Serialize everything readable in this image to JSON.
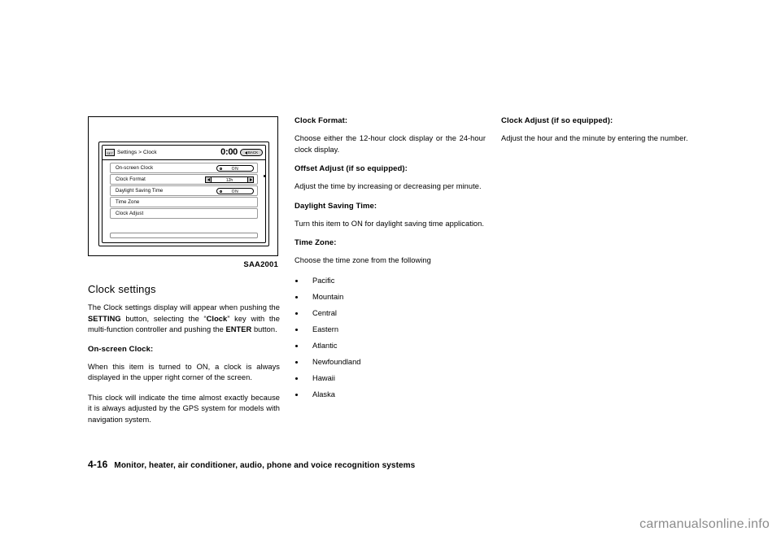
{
  "figure": {
    "id": "SAA2001",
    "titlebar": {
      "icon": "settings-icon",
      "title": "Settings > Clock",
      "clock": "0:00",
      "back_label": "BACK"
    },
    "rows": [
      {
        "label": "On-screen Clock",
        "control": "toggle",
        "value": "ON"
      },
      {
        "label": "Clock Format",
        "control": "stepper",
        "value": "12h"
      },
      {
        "label": "Daylight Saving Time",
        "control": "toggle",
        "value": "ON"
      },
      {
        "label": "Time Zone",
        "control": "none",
        "value": ""
      },
      {
        "label": "Clock Adjust",
        "control": "none",
        "value": ""
      }
    ]
  },
  "left": {
    "heading": "Clock settings",
    "intro_1": "The Clock settings display will appear when pushing the ",
    "intro_bold_1": "SETTING",
    "intro_2": " button, selecting the “",
    "intro_bold_2": "Clock",
    "intro_3": "” key with the multi-function controller and pushing the ",
    "intro_bold_3": "ENTER",
    "intro_4": " button.",
    "sub1": "On-screen Clock:",
    "p1": "When this item is turned to ON, a clock is always displayed in the upper right corner of the screen.",
    "p2": "This clock will indicate the time almost exactly because it is always adjusted by the GPS system for models with navigation system."
  },
  "mid": {
    "sub1": "Clock Format:",
    "p1": "Choose either the 12-hour clock display or the 24-hour clock display.",
    "sub2": "Offset Adjust (if so equipped):",
    "p2": "Adjust the time by increasing or decreasing per minute.",
    "sub3": "Daylight Saving Time:",
    "p3": "Turn this item to ON for daylight saving time application.",
    "sub4": "Time Zone:",
    "p4": "Choose the time zone from the following",
    "zones": [
      "Pacific",
      "Mountain",
      "Central",
      "Eastern",
      "Atlantic",
      "Newfoundland",
      "Hawaii",
      "Alaska"
    ]
  },
  "right": {
    "sub1": "Clock Adjust (if so equipped):",
    "p1": "Adjust the hour and the minute by entering the number."
  },
  "footer": {
    "page": "4-16",
    "text": "Monitor, heater, air conditioner, audio, phone and voice recognition systems"
  },
  "watermark": "carmanualsonline.info"
}
